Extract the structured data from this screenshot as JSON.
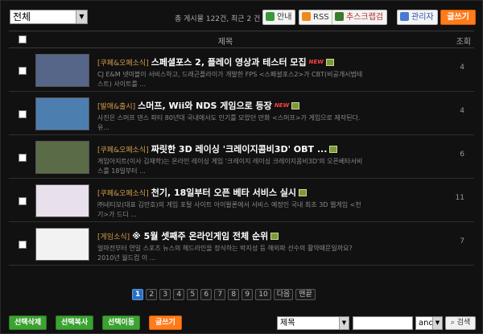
{
  "top": {
    "category_select": "전체",
    "post_info": "총 게시물 122건, 최근 2 건",
    "buttons": {
      "guide": "안내",
      "rss": "RSS",
      "scrap": "추스크랩검",
      "admin": "관리자",
      "write": "글쓰기"
    }
  },
  "table": {
    "header_title": "제목",
    "header_views": "조회",
    "new_label": "NEW",
    "rows": [
      {
        "category": "[쿠폐&오폐소식]",
        "title": "스페셜포스 2, 플레이 영상과 테스터 모집",
        "is_new": true,
        "has_image": true,
        "desc": "CJ E&M 넷마블이 서비스하고, 드래곤플라이가 개발한 FPS <스페셜포스2>가 CBT(비공개시범테스트) 사이트를 ...",
        "views": "4",
        "thumb_color": "#556688"
      },
      {
        "category": "[발매&출시]",
        "title": "스머프, Wii와 NDS 게임으로 등장",
        "is_new": true,
        "has_image": true,
        "desc": "사진은 스머프 댄스 파티      80년대 국내에서도 인기를 모았던 만화 <스머프>가 게임으로 제작된다. 유...",
        "views": "4",
        "thumb_color": "#4c7fb0"
      },
      {
        "category": "[쿠폐&오폐소식]",
        "title": "짜릿한 3D 레이싱 '크레이지콤비3D' OBT ...",
        "is_new": false,
        "has_image": true,
        "desc": "게임아지트(이사 김재학)는 온라인 레이싱 게임 '크레이지 레이싱 크레이지콤비3D'의 오픈베타서비스를 18일부터 ...",
        "views": "6",
        "thumb_color": "#5a6b48"
      },
      {
        "category": "[쿠폐&오폐소식]",
        "title": "천기, 18일부터 오픈 베타 서비스 실시",
        "is_new": false,
        "has_image": true,
        "desc": "㈜네티모(대표 김만호)의 게임 포탈 사이트 아이윌론에서 서비스 예정인 국내 최초 3D 웹게임 <천기>가 드디 ...",
        "views": "11",
        "thumb_color": "#e8e0ea"
      },
      {
        "category": "[게임소식]",
        "title": "※ 5월 셋째주 온라인게임 전체 순위",
        "is_new": false,
        "has_image": true,
        "desc": "얼마전부터 연일 스포츠 뉴스의 헤드라인을 장식하는 박지성 등 해외파 선수의 활약때문일까요? 2010년 월드컵 이 ...",
        "views": "7",
        "thumb_color": "#f2f2f2"
      }
    ]
  },
  "pagination": {
    "pages": [
      "1",
      "2",
      "3",
      "4",
      "5",
      "6",
      "7",
      "8",
      "9",
      "10"
    ],
    "current": "1",
    "next": "다음",
    "last": "맨끝"
  },
  "bottom": {
    "delete_selected": "선택삭제",
    "copy_selected": "선택복사",
    "move_selected": "선택이동",
    "write": "글쓰기",
    "search_field": "제목",
    "search_op": "and",
    "search_button": "검색"
  }
}
